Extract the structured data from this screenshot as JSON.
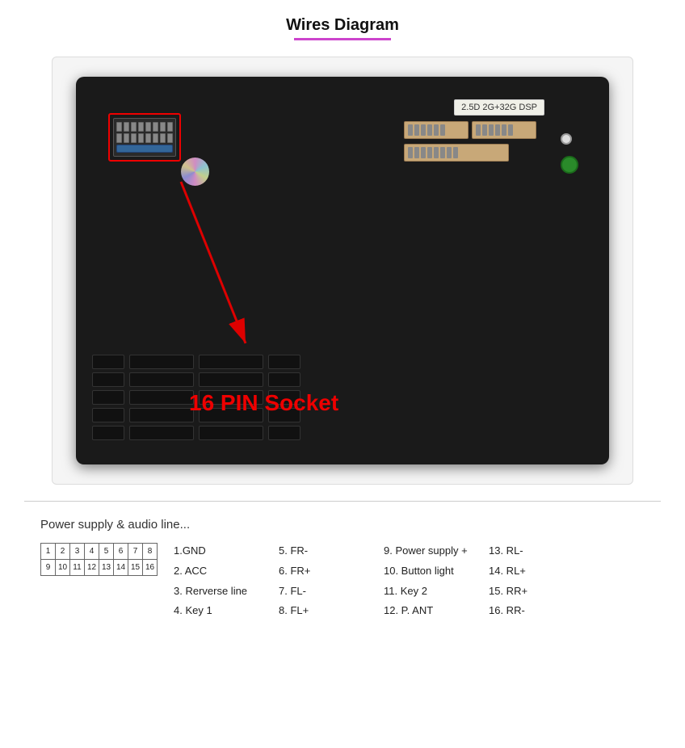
{
  "page": {
    "title": "Wires Diagram",
    "subtitle": "Power supply & audio line...",
    "sticker_text": "2.5D 2G+32G DSP",
    "pin_socket_label": "16 PIN Socket"
  },
  "pin_grid": {
    "row1": [
      "1",
      "2",
      "3",
      "4",
      "5",
      "6",
      "7",
      "8"
    ],
    "row2": [
      "9",
      "10",
      "11",
      "12",
      "13",
      "14",
      "15",
      "16"
    ]
  },
  "pin_definitions": {
    "col1": [
      "1.GND",
      "2. ACC",
      "3. Rerverse line",
      "4. Key 1"
    ],
    "col2": [
      "5. FR-",
      "6. FR+",
      "7. FL-",
      "8. FL+"
    ],
    "col3": [
      "9. Power supply +",
      "10. Button light",
      "11. Key 2",
      "12. P. ANT"
    ],
    "col4": [
      "13. RL-",
      "14. RL+",
      "15. RR+",
      "16. RR-"
    ]
  }
}
